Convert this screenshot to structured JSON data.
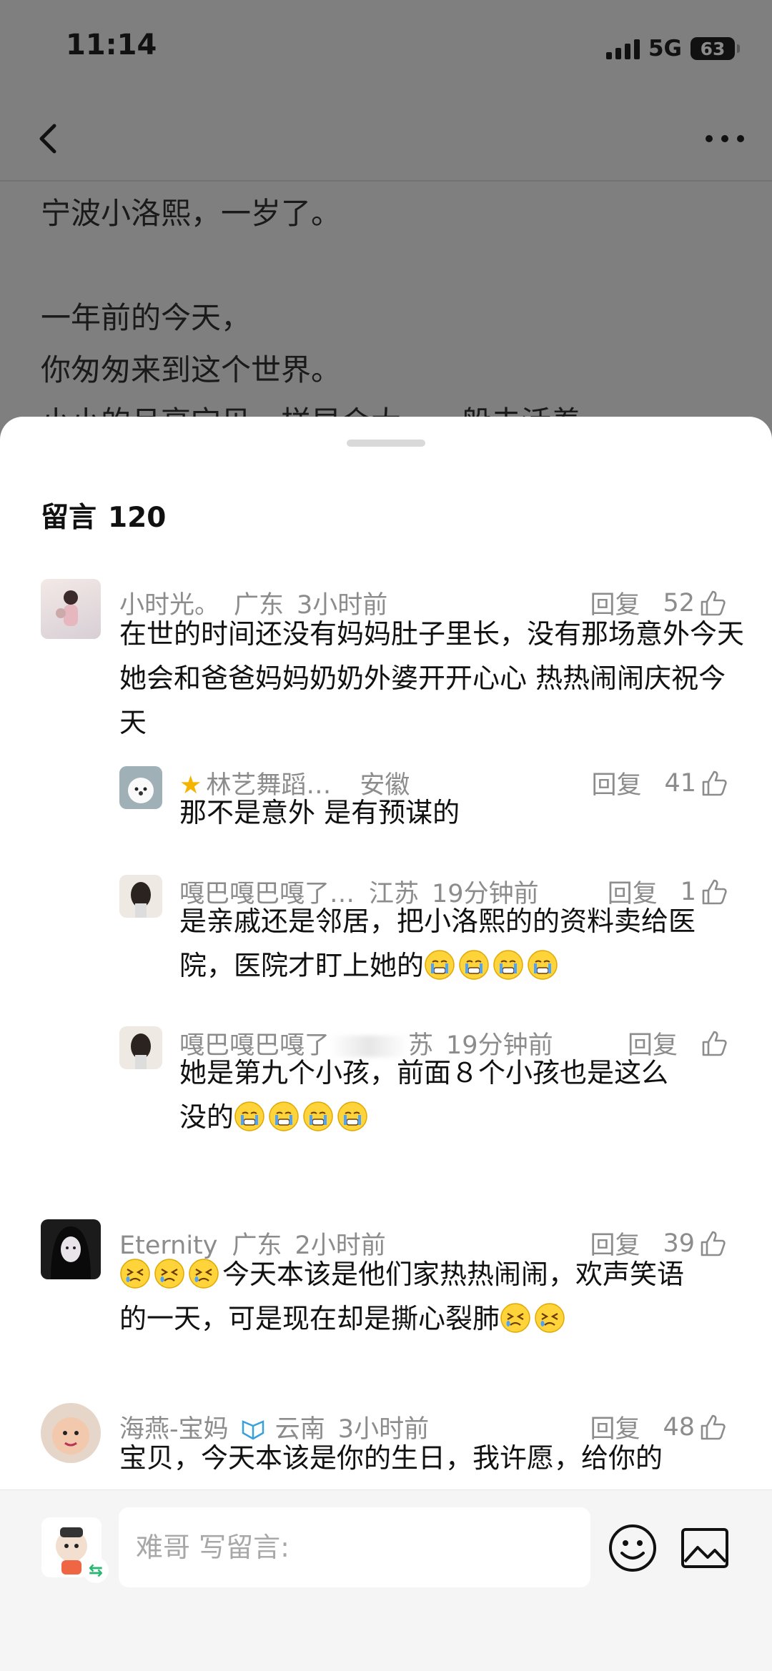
{
  "status_bar": {
    "time": "11:14",
    "network": "5G",
    "battery": "63"
  },
  "article": {
    "lines": [
      "宁波小洛熙，一岁了。",
      "",
      "一年前的今天，",
      "你匆匆来到这个世界。",
      "小小的月亮宝贝，样早会大，一般去活着"
    ]
  },
  "comments_sheet": {
    "title": "留言",
    "count": "120",
    "comments": [
      {
        "name": "小时光。",
        "location": "广东",
        "time": "3小时前",
        "reply_label": "回复",
        "likes": "52",
        "text": "在世的时间还没有妈妈肚子里长，没有那场意外今天她会和爸爸妈妈奶奶外婆开开心心 热热闹闹庆祝今天",
        "replies": [
          {
            "name": "林艺舞蹈…",
            "location": "安徽",
            "time": "",
            "reply_label": "回复",
            "likes": "41",
            "text": "那不是意外 是有预谋的"
          },
          {
            "name": "嘎巴嘎巴嘎了…",
            "location": "江苏",
            "time": "19分钟前",
            "reply_label": "回复",
            "likes": "1",
            "text": "是亲戚还是邻居，把小洛熙的的资料卖给医院，医院才盯上她的"
          },
          {
            "name": "嘎巴嘎巴嘎了",
            "location": "苏",
            "time": "19分钟前",
            "reply_label": "回复",
            "likes": "",
            "text_line1": "她是第九个小孩，前面８个小孩也是这么",
            "text_line2": "没的"
          }
        ]
      },
      {
        "name": "Eternity",
        "location": "广东",
        "time": "2小时前",
        "reply_label": "回复",
        "likes": "39",
        "text_a": "今天本该是他们家热热闹闹，欢声笑语",
        "text_b": "的一天，可是现在却是撕心裂肺"
      },
      {
        "name": "海燕-宝妈",
        "location": "云南",
        "time": "3小时前",
        "reply_label": "回复",
        "likes": "48",
        "text": "宝贝，今天本该是你的生日，我许愿，给你的"
      }
    ]
  },
  "input_bar": {
    "placeholder": "难哥 写留言:"
  },
  "icons": {
    "back": "chevron-left-icon",
    "more": "ellipsis-icon",
    "like": "thumbs-up-icon",
    "emoji": "smiley-icon",
    "image": "image-icon",
    "crying": "crying-emoji",
    "persevere": "persevering-emoji"
  }
}
